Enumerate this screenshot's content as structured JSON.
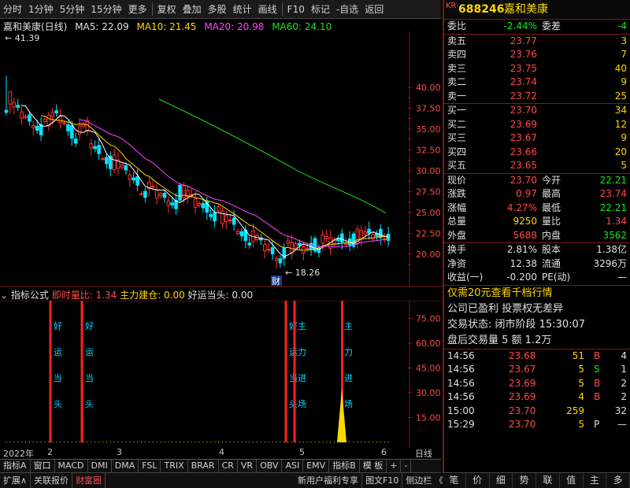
{
  "toolbar": {
    "items": [
      "分时",
      "1分钟",
      "5分钟",
      "15分钟",
      "更多",
      "复权",
      "叠加",
      "多股",
      "统计",
      "画线",
      "F10",
      "标记",
      "-自选",
      "返回"
    ]
  },
  "chart": {
    "name": "嘉和美康(日线)",
    "ma5": "MA5: 22.09",
    "ma10": "MA10: 21.45",
    "ma20": "MA20: 20.98",
    "ma60": "MA60: 24.10",
    "high_label": "41.39",
    "low_label": "18.26",
    "cai_label": "财",
    "y_ticks": [
      "40.00",
      "37.50",
      "35.00",
      "32.50",
      "30.00",
      "27.50",
      "25.00",
      "22.50",
      "20.00"
    ],
    "colors": {
      "ma5": "#ffffff",
      "ma10": "#ffd800",
      "ma20": "#ff44ff",
      "ma60": "#19e619",
      "up": "#ff3030",
      "down": "#00e5ff"
    }
  },
  "indicator": {
    "title": "指标公式",
    "label1": "即时量比: 1.34",
    "label2": "主力建仓: 0.00",
    "label3": "好运当头: 0.00",
    "y_ticks": [
      "75.00",
      "60.00",
      "45.00",
      "30.00",
      "15.00"
    ],
    "marks": [
      "好运当头",
      "好运当头",
      "好运当头",
      "主力进场"
    ]
  },
  "datebar": {
    "year": "2022年",
    "m2": "2",
    "m3": "3",
    "m4": "4",
    "m5": "5",
    "m6": "6",
    "right": "日线"
  },
  "tabs1": [
    "指标A",
    "窗口",
    "MACD",
    "DMI",
    "DMA",
    "FSL",
    "TRIX",
    "BRAR",
    "CR",
    "VR",
    "OBV",
    "ASI",
    "EMV",
    "指标B",
    "模 板",
    "+",
    "-"
  ],
  "tabs2": [
    "扩展∧",
    "关联报价",
    "财富圈",
    "新用户福利专享",
    "图文F10",
    "侧边栏 《"
  ],
  "quote": {
    "code": "688246",
    "name": "嘉和美康",
    "kr": "KR",
    "weibi_label": "委比",
    "weibi": "-2.44%",
    "weicha_label": "委差",
    "weicha": "-4",
    "sells": [
      [
        "卖五",
        "23.77",
        "3"
      ],
      [
        "卖四",
        "23.76",
        "7"
      ],
      [
        "卖三",
        "23.75",
        "40"
      ],
      [
        "卖二",
        "23.74",
        "9"
      ],
      [
        "卖一",
        "23.72",
        "25"
      ]
    ],
    "buys": [
      [
        "买一",
        "23.70",
        "34"
      ],
      [
        "买二",
        "23.69",
        "12"
      ],
      [
        "买三",
        "23.67",
        "9"
      ],
      [
        "买四",
        "23.66",
        "20"
      ],
      [
        "买五",
        "23.65",
        "5"
      ]
    ],
    "stats": [
      [
        "现价",
        "23.70",
        "今开",
        "22.21"
      ],
      [
        "涨跌",
        "0.97",
        "最高",
        "23.74"
      ],
      [
        "涨幅",
        "4.27%",
        "最低",
        "22.21"
      ],
      [
        "总量",
        "9250",
        "量比",
        "1.34"
      ],
      [
        "外盘",
        "5688",
        "内盘",
        "3562"
      ]
    ],
    "fund": [
      [
        "换手",
        "2.81%",
        "股本",
        "1.38亿"
      ],
      [
        "净资",
        "12.38",
        "流通",
        "3296万"
      ],
      [
        "收益(一)",
        "-0.200",
        "PE(动)",
        "—"
      ]
    ],
    "promo": "仅需20元查看千档行情",
    "info1": "公司已盈利 投票权无差异",
    "status": "交易状态: 闭市阶段 15:30:07",
    "after": "盘后交易量 5 额 1.2万",
    "ticks": [
      [
        "14:56",
        "23.68",
        "51",
        "B",
        "4"
      ],
      [
        "14:56",
        "23.67",
        "5",
        "S",
        "1"
      ],
      [
        "14:56",
        "23.69",
        "5",
        "B",
        "2"
      ],
      [
        "14:56",
        "23.69",
        "4",
        "B",
        "2"
      ],
      [
        "15:00",
        "23.70",
        "259",
        "",
        "32"
      ],
      [
        "15:29",
        "23.70",
        "5",
        "P",
        "—"
      ]
    ],
    "icons": [
      "笔",
      "价",
      "细",
      "势",
      "联",
      "值",
      "主",
      "多"
    ]
  }
}
